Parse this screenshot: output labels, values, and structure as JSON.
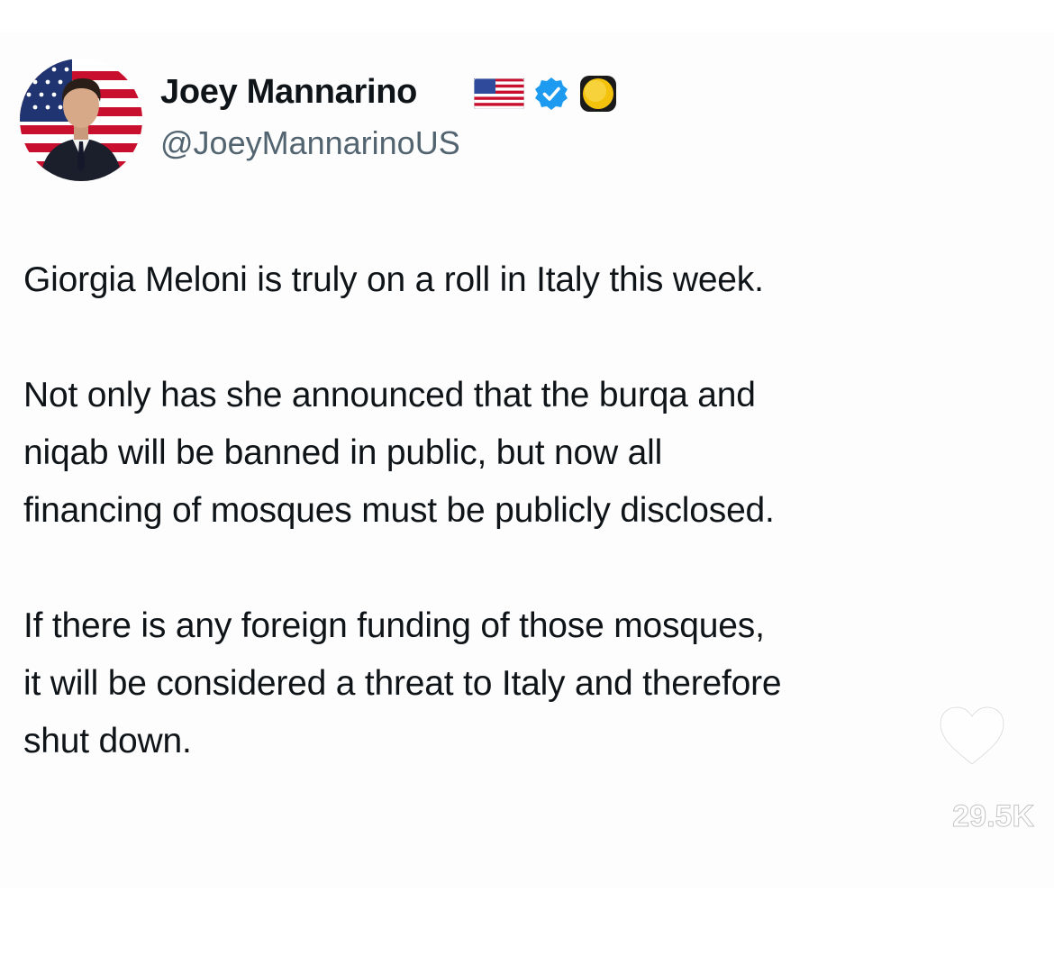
{
  "author": {
    "display_name": "Joey Mannarino",
    "handle": "@JoeyMannarinoUS",
    "avatar_icon": "avatar-man-in-suit-with-american-flag",
    "badges": [
      "us-flag-icon",
      "verified-badge-icon",
      "yellow-circle-icon"
    ]
  },
  "tweet": {
    "paragraphs": [
      "Giorgia Meloni is truly on a roll in Italy this week.",
      "Not only has she announced that the burqa and\nniqab will be banned in public, but now all\nfinancing of mosques must be publicly disclosed.",
      "If there is any foreign funding of those mosques,\nit will be considered a threat to Italy and therefore\nshut down."
    ]
  },
  "overlay": {
    "like_icon": "heart-outline-icon",
    "like_count": "29.5K"
  },
  "colors": {
    "text": "#0f1419",
    "handle": "#536471",
    "verified": "#1d9bf0",
    "background": "#ffffff"
  }
}
